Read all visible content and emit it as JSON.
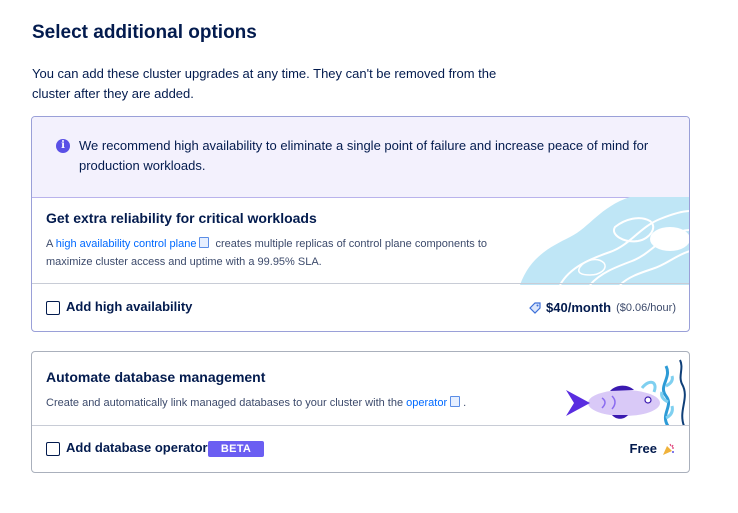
{
  "page": {
    "title": "Select additional options",
    "intro": "You can add these cluster upgrades at any time. They can't be removed from the cluster after they are added."
  },
  "ha_card": {
    "notice": "We recommend high availability to eliminate a single point of failure and increase peace of mind for production workloads.",
    "title": "Get extra reliability for critical workloads",
    "desc_prefix": "A",
    "link_text": "high availability control plane",
    "desc_suffix": "creates multiple replicas of control plane components to maximize cluster access and uptime with a 99.95% SLA.",
    "checkbox_label": "Add high availability",
    "checked": false,
    "price": "$40/month",
    "price_hourly": "($0.06/hour)"
  },
  "db_card": {
    "title": "Automate database management",
    "desc_prefix": "Create and automatically link managed databases to your cluster with the",
    "link_text": "operator",
    "desc_suffix": ".",
    "checkbox_label": "Add database operator",
    "checked": false,
    "badge": "BETA",
    "price": "Free"
  },
  "colors": {
    "accent": "#0069ff",
    "badge": "#6b5ef2",
    "notice_bg": "#f3f1fd",
    "text": "#031b4e"
  },
  "icons": [
    "info-icon",
    "doc-icon",
    "tag-icon",
    "party-popper-icon",
    "topographic-illustration",
    "fish-seaweed-illustration"
  ]
}
